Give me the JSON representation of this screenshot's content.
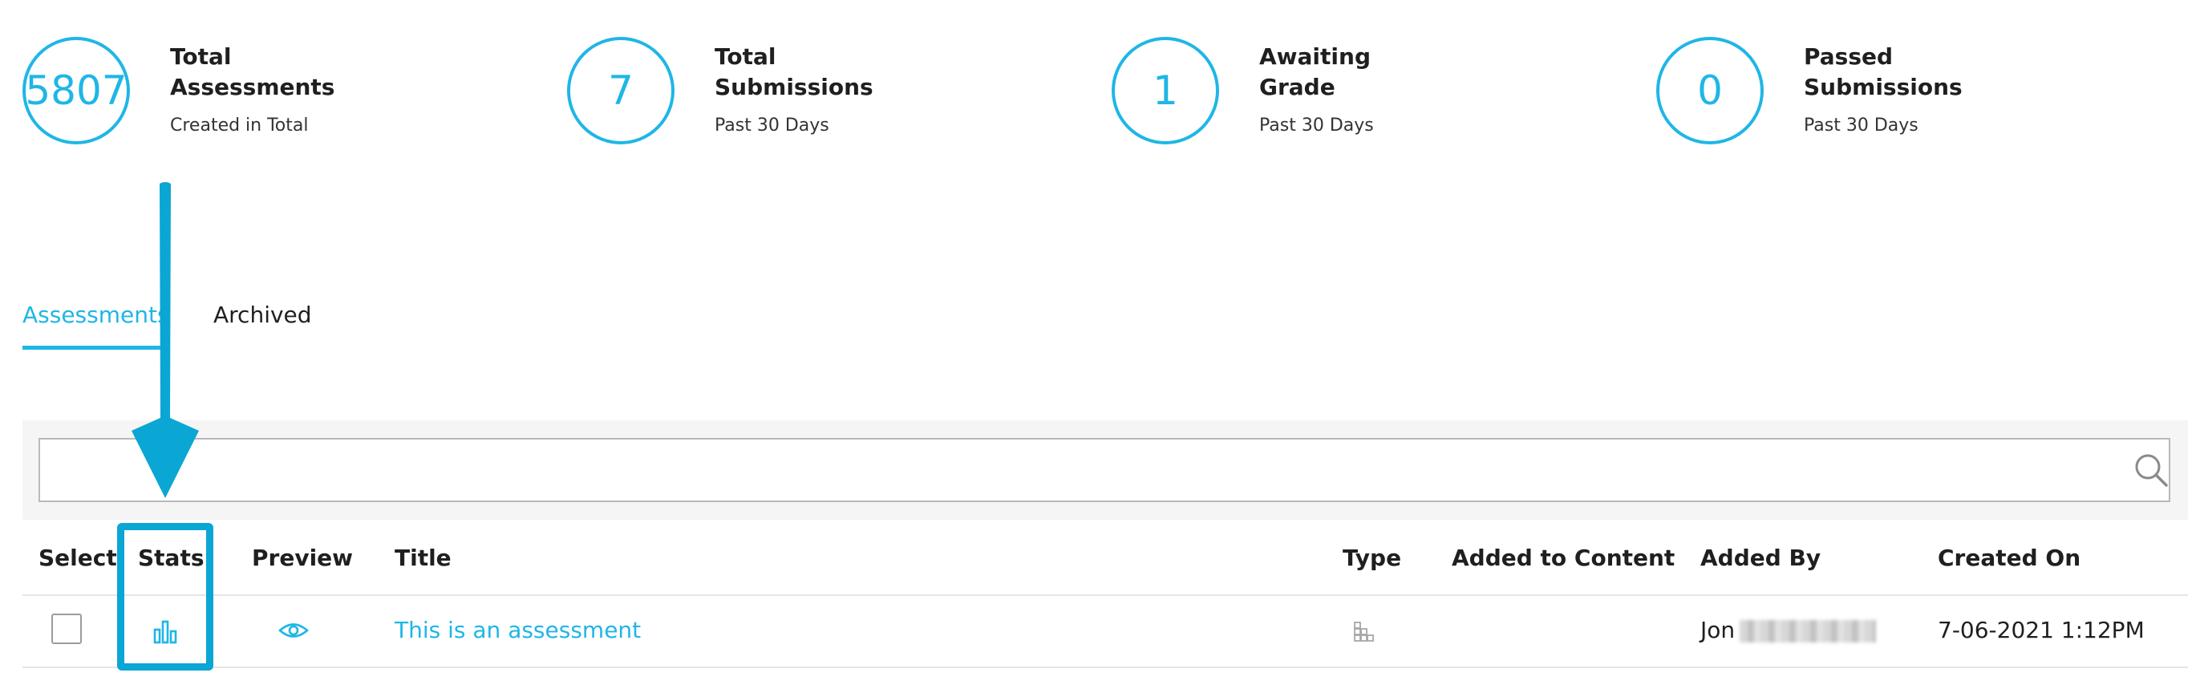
{
  "stats": [
    {
      "value": "5807",
      "title_line1": "Total",
      "title_line2": "Assessments",
      "subtitle": "Created in Total"
    },
    {
      "value": "7",
      "title_line1": "Total",
      "title_line2": "Submissions",
      "subtitle": "Past 30 Days"
    },
    {
      "value": "1",
      "title_line1": "Awaiting",
      "title_line2": "Grade",
      "subtitle": "Past 30 Days"
    },
    {
      "value": "0",
      "title_line1": "Passed",
      "title_line2": "Submissions",
      "subtitle": "Past 30 Days"
    }
  ],
  "tabs": {
    "active": "Assessments",
    "inactive": "Archived"
  },
  "search": {
    "placeholder": "",
    "value": ""
  },
  "table": {
    "headers": {
      "select": "Select",
      "stats": "Stats",
      "preview": "Preview",
      "title": "Title",
      "type": "Type",
      "added_to_content": "Added to Content",
      "added_by": "Added By",
      "created_on": "Created On"
    },
    "rows": [
      {
        "title": "This is an assessment",
        "added_to_content": "",
        "added_by": "Jon",
        "created_on": "7-06-2021 1:12PM"
      }
    ]
  },
  "colors": {
    "accent": "#1fb6e6",
    "highlight": "#0aa6d4"
  },
  "icons": {
    "stats": "bar-chart-icon",
    "preview": "eye-icon",
    "type": "grid-blocks-icon",
    "search": "search-icon"
  }
}
